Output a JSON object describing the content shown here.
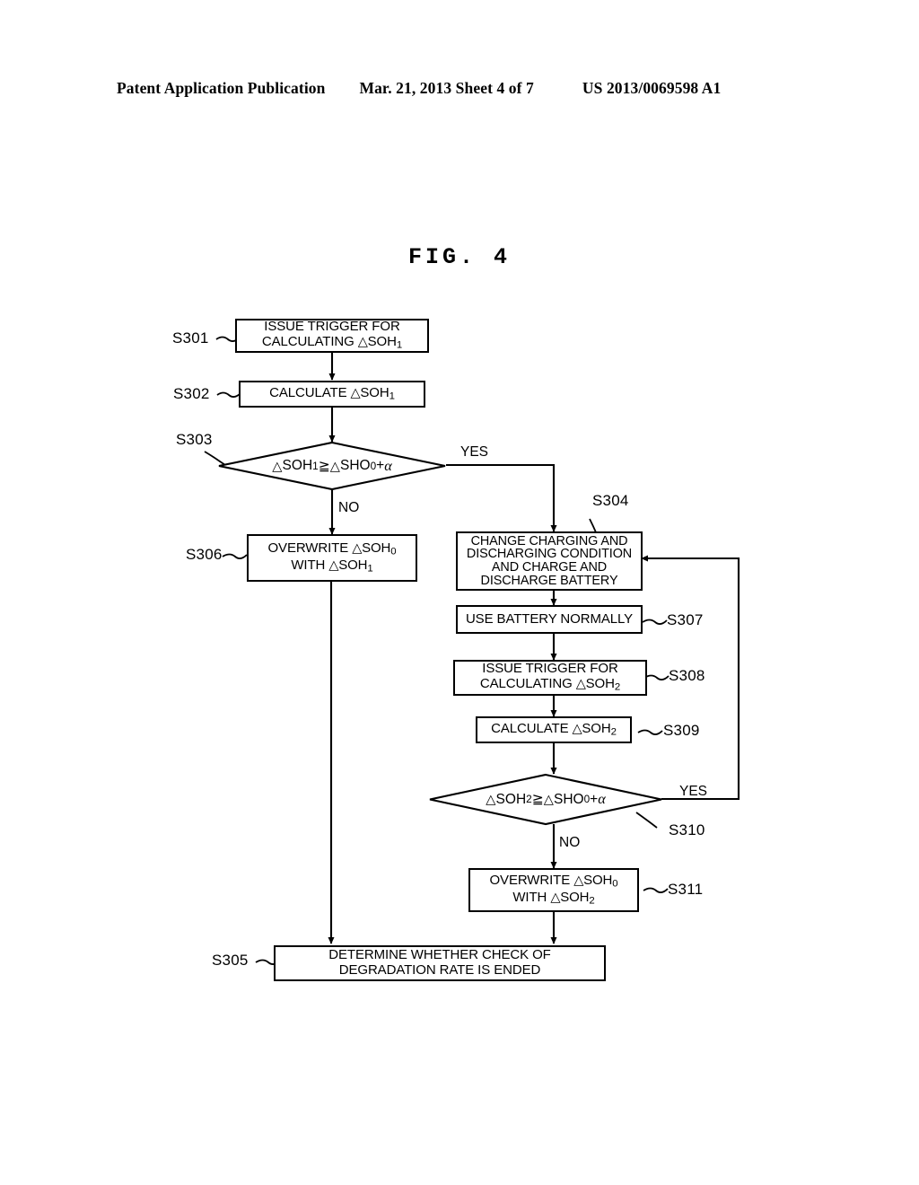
{
  "header": {
    "publication": "Patent Application Publication",
    "date_sheet": "Mar. 21, 2013  Sheet 4 of 7",
    "patent_number": "US 2013/0069598 A1"
  },
  "figure": {
    "title": "FIG. 4"
  },
  "flowchart": {
    "nodes": [
      {
        "id": "S301",
        "tag": "S301",
        "shape": "process",
        "text": "ISSUE TRIGGER FOR\nCALCULATING △SOH1"
      },
      {
        "id": "S302",
        "tag": "S302",
        "shape": "process",
        "text": "CALCULATE △SOH1"
      },
      {
        "id": "S303",
        "tag": "S303",
        "shape": "decision",
        "text": "△SOH1 ≧ △SHO0+ α"
      },
      {
        "id": "S304",
        "tag": "S304",
        "shape": "process",
        "text": "CHANGE CHARGING AND\nDISCHARGING CONDITION\nAND CHARGE AND\nDISCHARGE BATTERY"
      },
      {
        "id": "S306",
        "tag": "S306",
        "shape": "process",
        "text": "OVERWRITE △SOH0\nWITH △SOH1"
      },
      {
        "id": "S307",
        "tag": "S307",
        "shape": "process",
        "text": "USE BATTERY NORMALLY"
      },
      {
        "id": "S308",
        "tag": "S308",
        "shape": "process",
        "text": "ISSUE TRIGGER FOR\nCALCULATING △SOH2"
      },
      {
        "id": "S309",
        "tag": "S309",
        "shape": "process",
        "text": "CALCULATE △SOH2"
      },
      {
        "id": "S310",
        "tag": "S310",
        "shape": "decision",
        "text": "△SOH2 ≧ △SHO0+ α"
      },
      {
        "id": "S311",
        "tag": "S311",
        "shape": "process",
        "text": "OVERWRITE △SOH0\nWITH △SOH2"
      },
      {
        "id": "S305",
        "tag": "S305",
        "shape": "process",
        "text": "DETERMINE WHETHER CHECK OF\nDEGRADATION RATE IS ENDED"
      }
    ],
    "branch_labels": {
      "s303_yes": "YES",
      "s303_no": "NO",
      "s310_yes": "YES",
      "s310_no": "NO"
    },
    "colors": {
      "line": "#000000",
      "fill": "#ffffff"
    }
  }
}
